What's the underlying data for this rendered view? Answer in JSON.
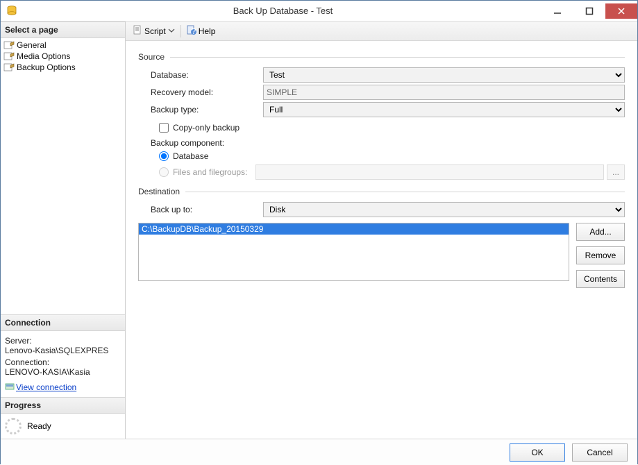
{
  "title": "Back Up Database - Test",
  "left": {
    "select_page": "Select a page",
    "pages": {
      "general": "General",
      "media": "Media Options",
      "backup": "Backup Options"
    },
    "connection_hdr": "Connection",
    "server_lbl": "Server:",
    "server_val": "Lenovo-Kasia\\SQLEXPRES",
    "conn_lbl": "Connection:",
    "conn_val": "LENOVO-KASIA\\Kasia",
    "view_conn": "View connection ",
    "progress_hdr": "Progress",
    "progress_state": "Ready"
  },
  "toolbar": {
    "script": "Script",
    "help": "Help"
  },
  "form": {
    "source": "Source",
    "database_lbl": "Database:",
    "database_val": "Test",
    "recovery_lbl": "Recovery model:",
    "recovery_val": "SIMPLE",
    "backup_type_lbl": "Backup type:",
    "backup_type_val": "Full",
    "copy_only": "Copy-only backup",
    "component_lbl": "Backup component:",
    "radio_db": "Database",
    "radio_fg": "Files and filegroups:",
    "fg_ellipsis": "...",
    "destination": "Destination",
    "backup_to_lbl": "Back up to:",
    "backup_to_val": "Disk",
    "dest_items": [
      "C:\\BackupDB\\Backup_20150329"
    ],
    "btn_add": "Add...",
    "btn_remove": "Remove",
    "btn_contents": "Contents"
  },
  "footer": {
    "ok": "OK",
    "cancel": "Cancel"
  }
}
